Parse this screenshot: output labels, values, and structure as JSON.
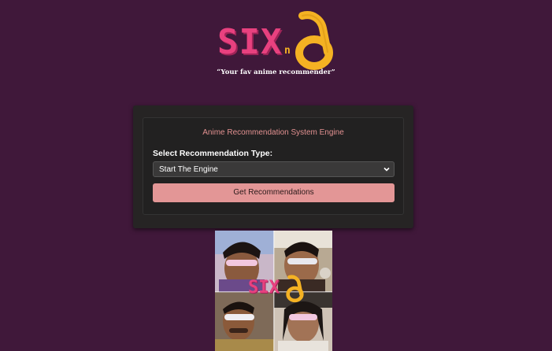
{
  "logo": {
    "wordmark": "SIX",
    "joiner": "n",
    "glyph": "δ",
    "tagline": "“Your fav anime recommender”",
    "colors": {
      "pink": "#e8417f",
      "yellow": "#f4b223"
    }
  },
  "card": {
    "title": "Anime Recommendation System Engine",
    "select_label": "Select Recommendation Type:",
    "select_value": "Start The Engine",
    "button_label": "Get Recommendations"
  },
  "collage": {
    "watermark_text": "SIX",
    "watermark_glyph": "δ"
  },
  "colors": {
    "background": "#40183a",
    "card": "#262424",
    "accent": "#e39696"
  }
}
